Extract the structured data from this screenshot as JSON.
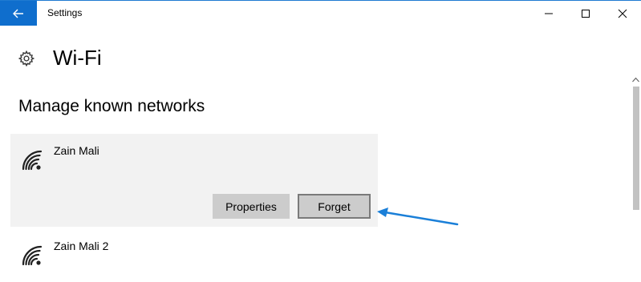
{
  "window": {
    "title": "Settings"
  },
  "page": {
    "title": "Wi-Fi",
    "section_title": "Manage known networks"
  },
  "networks": [
    {
      "name": "Zain Mali",
      "selected": true,
      "actions": {
        "properties_label": "Properties",
        "forget_label": "Forget"
      }
    },
    {
      "name": "Zain Mali 2",
      "selected": false
    }
  ],
  "icons": {
    "back": "back-arrow-icon",
    "minimize": "minimize-icon",
    "maximize": "maximize-icon",
    "close": "close-icon",
    "settings": "gear-icon",
    "network": "wifi-signal-icon",
    "annotation": "annotation-arrow"
  },
  "colors": {
    "accent": "#0f6ecd",
    "selected_row": "#f2f2f2",
    "button_bg": "#cccccc",
    "annotation_arrow": "#1a7fd8"
  }
}
